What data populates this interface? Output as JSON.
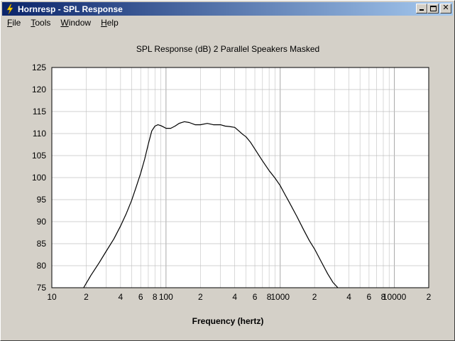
{
  "window": {
    "title": "Hornresp - SPL Response",
    "controls": {
      "minimize": "minimize",
      "maximize": "maximize",
      "close": "close"
    }
  },
  "menu": [
    {
      "label": "File",
      "key": "F",
      "rest": "ile"
    },
    {
      "label": "Tools",
      "key": "T",
      "rest": "ools"
    },
    {
      "label": "Window",
      "key": "W",
      "rest": "indow"
    },
    {
      "label": "Help",
      "key": "H",
      "rest": "elp"
    }
  ],
  "colors": {
    "titlebar_start": "#0a246a",
    "titlebar_end": "#a6caf0",
    "plot_bg": "#ffffff",
    "grid": "#c0c0c0",
    "curve": "#000000"
  },
  "chart_data": {
    "type": "line",
    "title": "SPL Response (dB)   2 Parallel Speakers   Masked",
    "xlabel": "Frequency (hertz)",
    "ylabel": "",
    "xscale": "log",
    "xlim": [
      10,
      20000
    ],
    "ylim": [
      75,
      125
    ],
    "grid": true,
    "legend": "none",
    "x_tick_labels": [
      {
        "value": 10,
        "label": "10"
      },
      {
        "value": 20,
        "label": "2"
      },
      {
        "value": 40,
        "label": "4"
      },
      {
        "value": 60,
        "label": "6"
      },
      {
        "value": 80,
        "label": "8"
      },
      {
        "value": 100,
        "label": "100"
      },
      {
        "value": 200,
        "label": "2"
      },
      {
        "value": 400,
        "label": "4"
      },
      {
        "value": 600,
        "label": "6"
      },
      {
        "value": 800,
        "label": "8"
      },
      {
        "value": 1000,
        "label": "1000"
      },
      {
        "value": 2000,
        "label": "2"
      },
      {
        "value": 4000,
        "label": "4"
      },
      {
        "value": 6000,
        "label": "6"
      },
      {
        "value": 8000,
        "label": "8"
      },
      {
        "value": 10000,
        "label": "10000"
      },
      {
        "value": 20000,
        "label": "2"
      }
    ],
    "y_tick_labels": [
      "75",
      "80",
      "85",
      "90",
      "95",
      "100",
      "105",
      "110",
      "115",
      "120",
      "125"
    ],
    "series": [
      {
        "x": [
          19,
          22,
          26,
          30,
          35,
          40,
          45,
          50,
          55,
          60,
          65,
          70,
          75,
          80,
          85,
          90,
          95,
          100,
          110,
          120,
          130,
          145,
          160,
          180,
          200,
          230,
          260,
          300,
          330,
          360,
          400,
          430,
          470,
          500,
          550,
          600,
          650,
          700,
          800,
          900,
          1000,
          1100,
          1200,
          1400,
          1600,
          1800,
          2000,
          2300,
          2600,
          2900,
          3200
        ],
        "y": [
          75,
          77.8,
          80.7,
          83.3,
          86.1,
          89.0,
          91.9,
          94.8,
          98.0,
          101.0,
          104.2,
          107.6,
          110.6,
          111.7,
          112.0,
          111.8,
          111.5,
          111.2,
          111.2,
          111.7,
          112.3,
          112.7,
          112.5,
          112.0,
          112.0,
          112.3,
          112.0,
          112.0,
          111.7,
          111.6,
          111.4,
          110.7,
          109.8,
          109.3,
          108.0,
          106.5,
          105.1,
          103.8,
          101.6,
          99.9,
          98.2,
          96.2,
          94.4,
          91.2,
          88.2,
          85.7,
          83.8,
          80.8,
          78.2,
          76.2,
          74.9
        ]
      }
    ]
  }
}
